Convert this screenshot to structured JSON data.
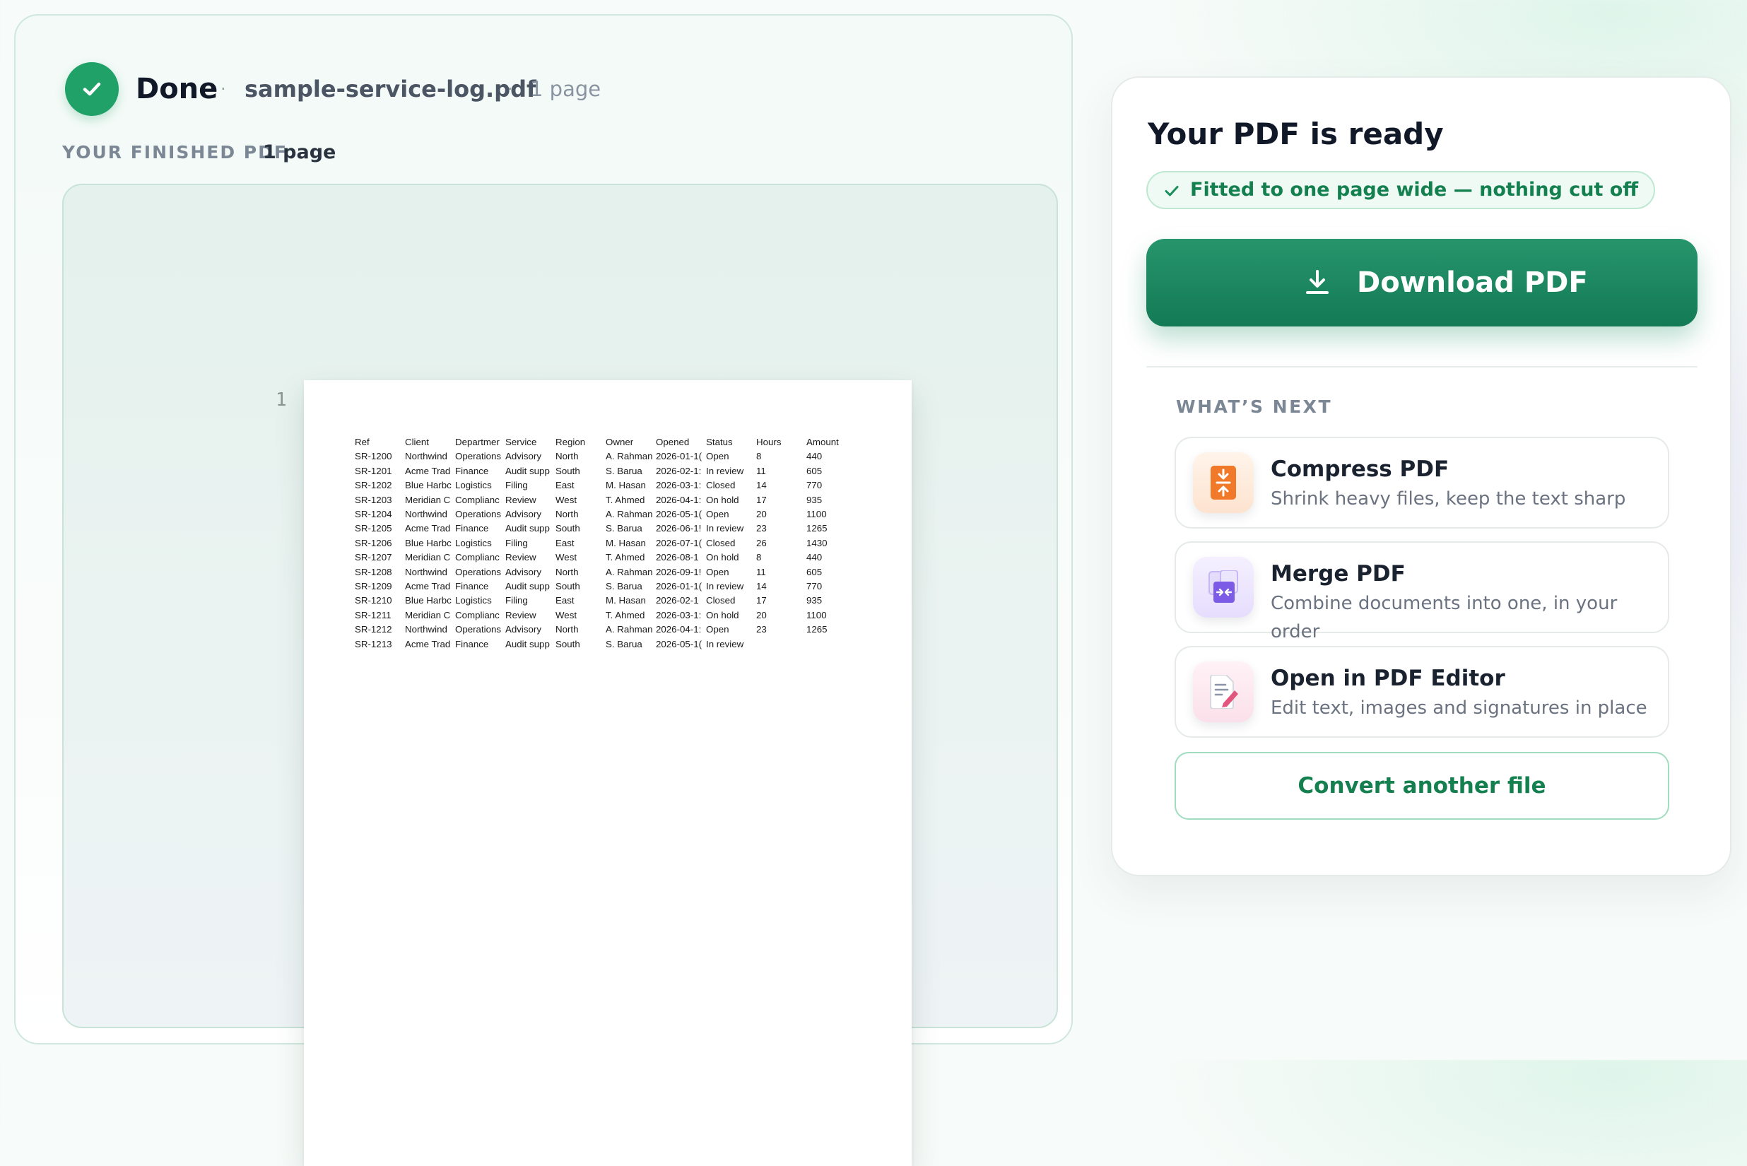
{
  "status": {
    "done_label": "Done",
    "separator": "·",
    "file_name": "sample-service-log.pdf",
    "page_count": "1 page"
  },
  "preview": {
    "section_label": "YOUR FINISHED PDF",
    "section_pages": "1 page",
    "page_number": "1",
    "table": {
      "headers": [
        "Ref",
        "Client",
        "Departmer",
        "Service",
        "Region",
        "Owner",
        "Opened",
        "Status",
        "Hours",
        "Amount"
      ],
      "rows": [
        [
          "SR-1200",
          "Northwind",
          "Operations",
          "Advisory",
          "North",
          "A. Rahman",
          "2026-01-1(",
          "Open",
          "8",
          "440"
        ],
        [
          "SR-1201",
          "Acme Trad",
          "Finance",
          "Audit supp",
          "South",
          "S. Barua",
          "2026-02-1:",
          "In review",
          "11",
          "605"
        ],
        [
          "SR-1202",
          "Blue Harbc",
          "Logistics",
          "Filing",
          "East",
          "M. Hasan",
          "2026-03-1:",
          "Closed",
          "14",
          "770"
        ],
        [
          "SR-1203",
          "Meridian C",
          "Complianc",
          "Review",
          "West",
          "T. Ahmed",
          "2026-04-1:",
          "On hold",
          "17",
          "935"
        ],
        [
          "SR-1204",
          "Northwind",
          "Operations",
          "Advisory",
          "North",
          "A. Rahman",
          "2026-05-1(",
          "Open",
          "20",
          "1100"
        ],
        [
          "SR-1205",
          "Acme Trad",
          "Finance",
          "Audit supp",
          "South",
          "S. Barua",
          "2026-06-1!",
          "In review",
          "23",
          "1265"
        ],
        [
          "SR-1206",
          "Blue Harbc",
          "Logistics",
          "Filing",
          "East",
          "M. Hasan",
          "2026-07-1(",
          "Closed",
          "26",
          "1430"
        ],
        [
          "SR-1207",
          "Meridian C",
          "Complianc",
          "Review",
          "West",
          "T. Ahmed",
          "2026-08-1",
          "On hold",
          "8",
          "440"
        ],
        [
          "SR-1208",
          "Northwind",
          "Operations",
          "Advisory",
          "North",
          "A. Rahman",
          "2026-09-1!",
          "Open",
          "11",
          "605"
        ],
        [
          "SR-1209",
          "Acme Trad",
          "Finance",
          "Audit supp",
          "South",
          "S. Barua",
          "2026-01-1(",
          "In review",
          "14",
          "770"
        ],
        [
          "SR-1210",
          "Blue Harbc",
          "Logistics",
          "Filing",
          "East",
          "M. Hasan",
          "2026-02-1",
          "Closed",
          "17",
          "935"
        ],
        [
          "SR-1211",
          "Meridian C",
          "Complianc",
          "Review",
          "West",
          "T. Ahmed",
          "2026-03-1:",
          "On hold",
          "20",
          "1100"
        ],
        [
          "SR-1212",
          "Northwind",
          "Operations",
          "Advisory",
          "North",
          "A. Rahman",
          "2026-04-1:",
          "Open",
          "23",
          "1265"
        ],
        [
          "SR-1213",
          "Acme Trad",
          "Finance",
          "Audit supp",
          "South",
          "S. Barua",
          "2026-05-1(",
          "In review",
          "",
          ""
        ]
      ]
    }
  },
  "ready_panel": {
    "title": "Your PDF is ready",
    "fit_notice": "Fitted to one page wide — nothing cut off",
    "download_label": "Download PDF",
    "next_label": "WHAT’S NEXT",
    "next_items": [
      {
        "title": "Compress PDF",
        "description": "Shrink heavy files, keep the text sharp",
        "icon": "compress-icon"
      },
      {
        "title": "Merge PDF",
        "description": "Combine documents into one, in your order",
        "icon": "merge-icon"
      },
      {
        "title": "Open in PDF Editor",
        "description": "Edit text, images and signatures in place",
        "icon": "edit-pdf-icon"
      }
    ],
    "convert_label": "Convert another file"
  },
  "colors": {
    "accent_green": "#1fa168",
    "download_green": "#137a56",
    "compress_orange": "#f07a2a",
    "merge_purple": "#7c5ce6",
    "edit_pink": "#e2557f"
  }
}
